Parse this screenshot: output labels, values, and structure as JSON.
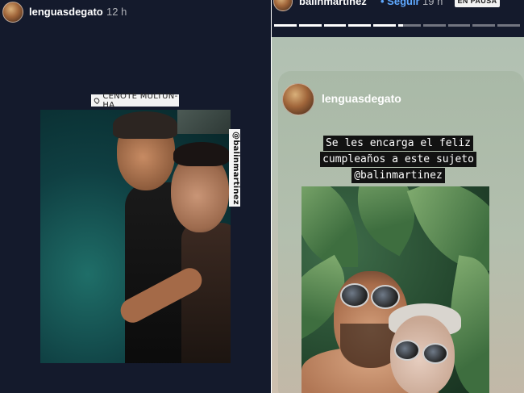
{
  "left_story": {
    "username": "lenguasdegato",
    "timestamp": "12 h",
    "location_sticker": "CENOTE MULTUN-HA",
    "mention_sticker": "@balinmartinez"
  },
  "right_story": {
    "header": {
      "username": "balinmartinez",
      "follow": "• Seguir",
      "timestamp": "19 h",
      "paused_badge": "EN PAUSA"
    },
    "progress": [
      1,
      1,
      1,
      1,
      1,
      0.2,
      0,
      0,
      0,
      0
    ],
    "reshare": {
      "username": "lenguasdegato",
      "caption_lines": [
        "Se les encarga el feliz",
        "cumpleaños a este sujeto",
        "@balinmartinez"
      ]
    }
  }
}
